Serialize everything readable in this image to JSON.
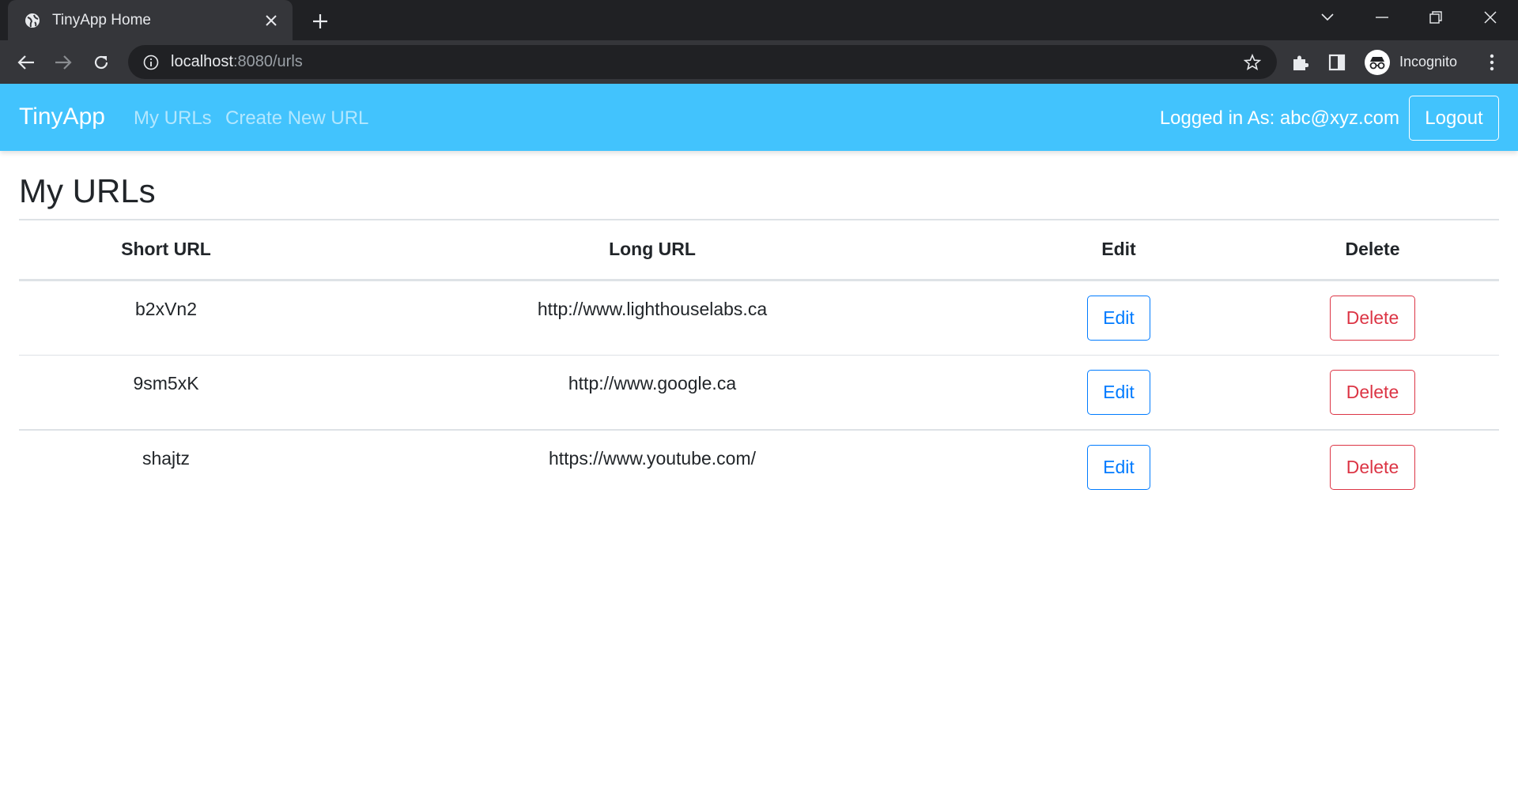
{
  "browser": {
    "tab_title": "TinyApp Home",
    "url_host": "localhost",
    "url_path": ":8080/urls",
    "profile_label": "Incognito"
  },
  "nav": {
    "brand": "TinyApp",
    "links": [
      "My URLs",
      "Create New URL"
    ],
    "logged_in_text": "Logged in As: abc@xyz.com",
    "logout_label": "Logout",
    "bg_color": "#42c3fd"
  },
  "page": {
    "title": "My URLs",
    "table": {
      "headers": [
        "Short URL",
        "Long URL",
        "Edit",
        "Delete"
      ],
      "rows": [
        {
          "short": "b2xVn2",
          "long": "http://www.lighthouselabs.ca",
          "edit": "Edit",
          "delete": "Delete"
        },
        {
          "short": "9sm5xK",
          "long": "http://www.google.ca",
          "edit": "Edit",
          "delete": "Delete"
        },
        {
          "short": "shajtz",
          "long": "https://www.youtube.com/",
          "edit": "Edit",
          "delete": "Delete"
        }
      ]
    }
  },
  "colors": {
    "edit_button": "#007bff",
    "delete_button": "#dc3545"
  }
}
